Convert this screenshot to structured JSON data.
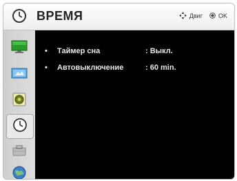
{
  "header": {
    "title": "ВРЕМЯ",
    "icon": "clock-icon",
    "hint_move_label": "Двиг",
    "hint_ok_label": "OK"
  },
  "sidebar": {
    "items": [
      {
        "icon": "picture-icon",
        "active": false
      },
      {
        "icon": "screen-icon",
        "active": false
      },
      {
        "icon": "audio-icon",
        "active": false
      },
      {
        "icon": "clock-icon",
        "active": true
      },
      {
        "icon": "lock-icon",
        "active": false
      },
      {
        "icon": "globe-icon",
        "active": false
      }
    ]
  },
  "menu": {
    "items": [
      {
        "bullet": "•",
        "label": "Таймер сна",
        "value": ": Выкл."
      },
      {
        "bullet": "•",
        "label": "Автовыключение",
        "value": ": 60 min."
      }
    ]
  },
  "colors": {
    "content_bg": "#000000",
    "text": "#e8e8e8",
    "header_bg": "#f2f2f2"
  }
}
